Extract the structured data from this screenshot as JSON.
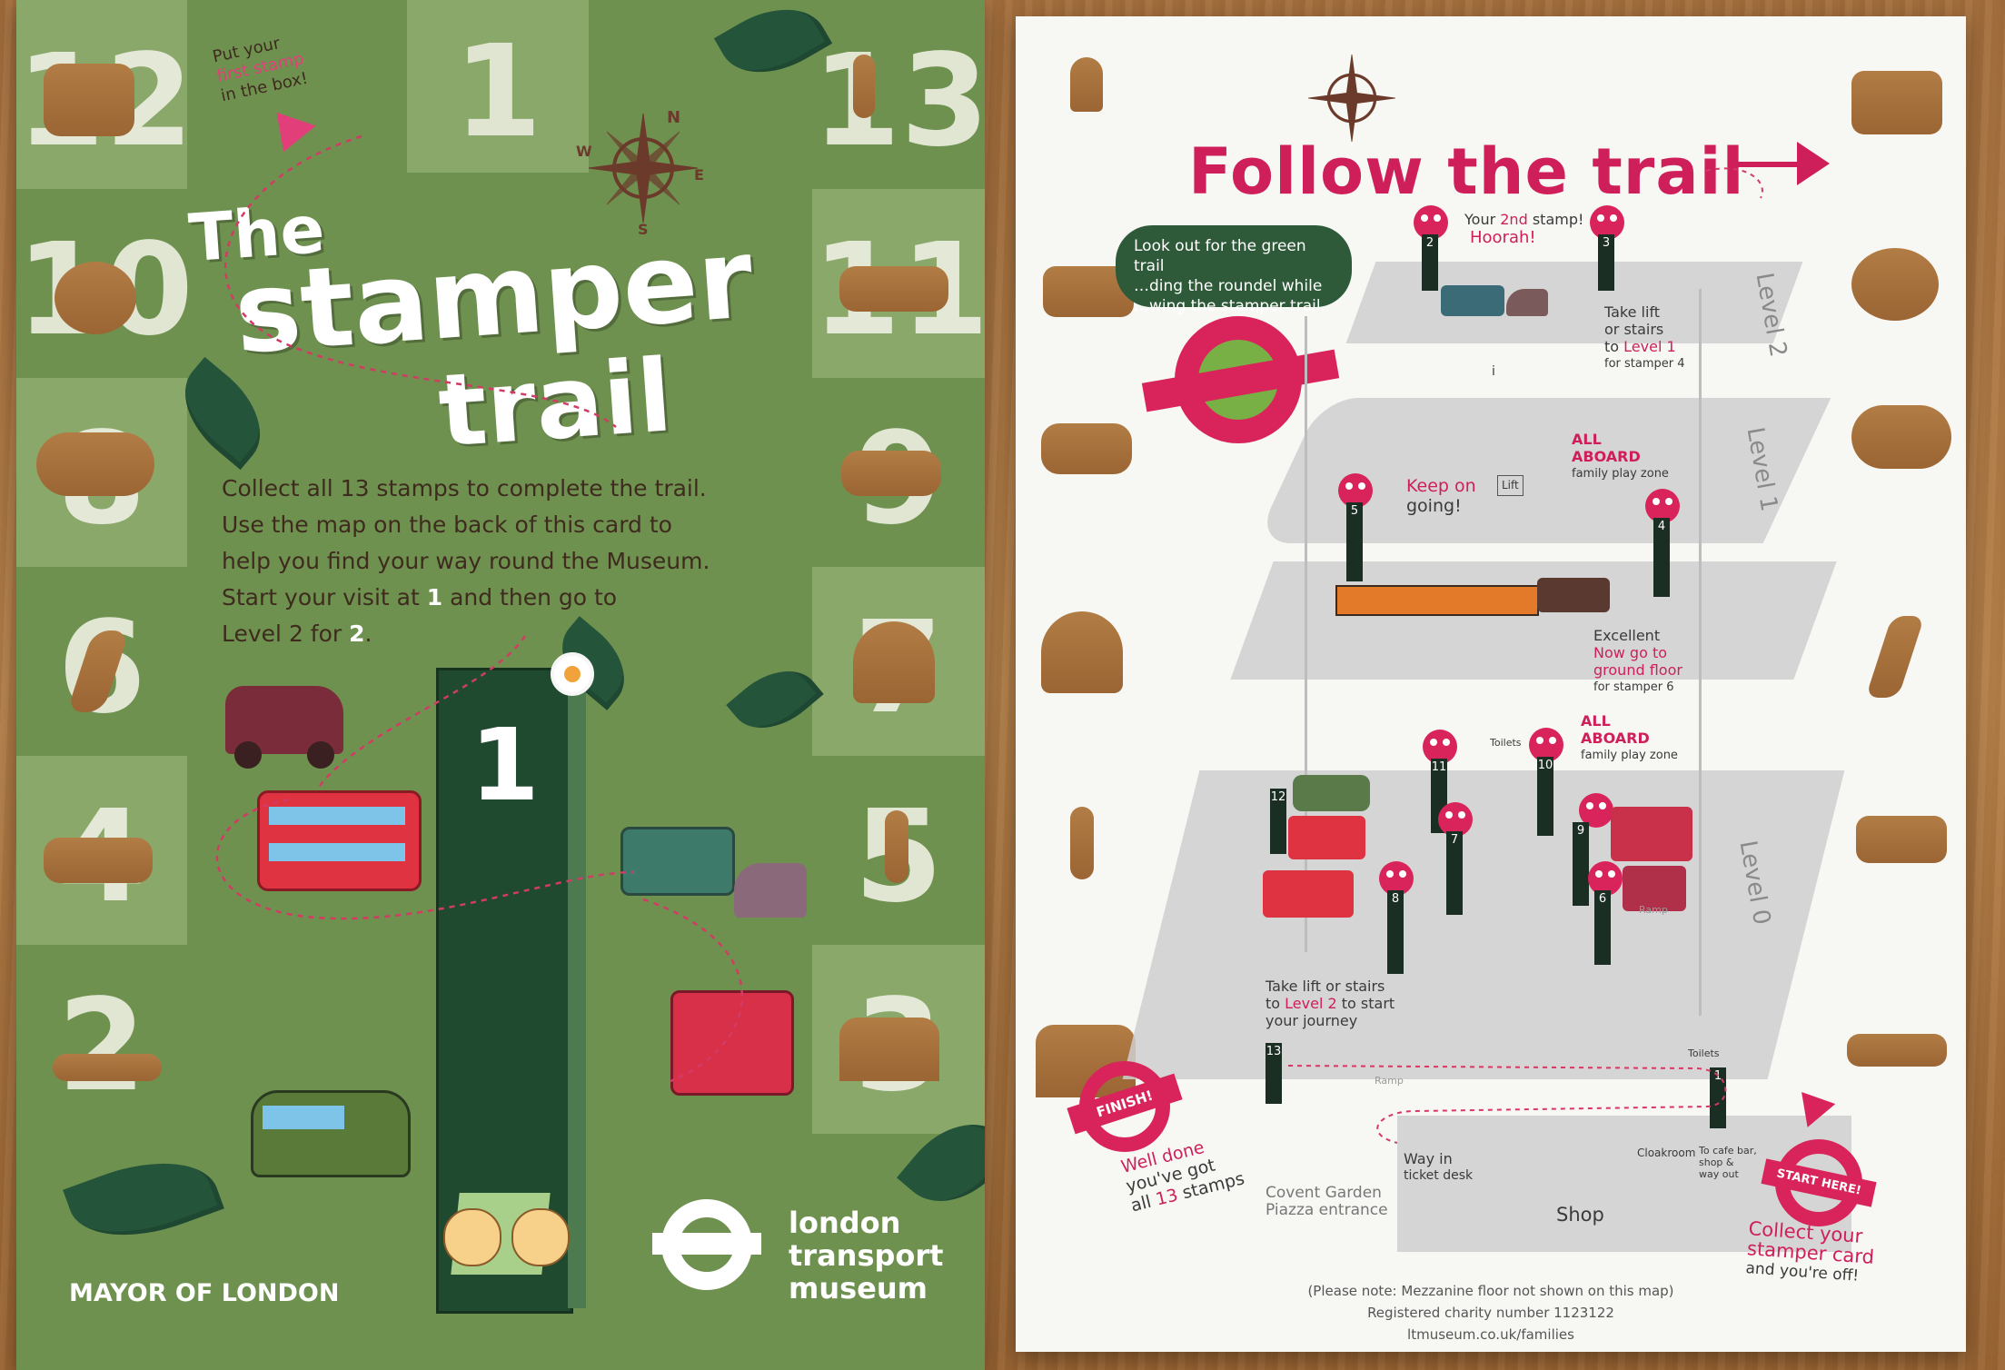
{
  "front": {
    "title_the": "The",
    "title_stamper": "stamper",
    "title_trail": "trail",
    "put_stamp_1": "Put your",
    "put_stamp_2": "first stamp",
    "put_stamp_3": "in the box!",
    "body_line1": "Collect all 13 stamps to complete the trail.",
    "body_line2": "Use the map on the back of this card to",
    "body_line3": "help you find your way round the Museum.",
    "start_a": "Start your visit at",
    "start_one": "1",
    "start_b": "and then go to",
    "start_c": "Level 2 for",
    "start_two": "2",
    "start_d": ".",
    "big_one": "1",
    "mayor": "MAYOR OF LONDON",
    "brand_1": "london",
    "brand_2": "transport",
    "brand_3": "museum",
    "left_numbers": [
      "12",
      "10",
      "8",
      "6",
      "4",
      "2"
    ],
    "top_number": "1",
    "right_numbers": [
      "13",
      "11",
      "9",
      "7",
      "5",
      "3"
    ],
    "colors": {
      "card_green": "#6f9150",
      "dark_green": "#1f4a30",
      "pink": "#e23f7a",
      "text_brown": "#3e2b1e"
    }
  },
  "back": {
    "title": "Follow the trail",
    "bubble_line1": "Look out for the green trail",
    "bubble_line2": "…ding the roundel while",
    "bubble_line3": "…wing the stamper trail.",
    "your_2nd_a": "Your",
    "your_2nd_b": "2nd",
    "your_2nd_c": "stamp!",
    "hoorah": "Hoorah!",
    "take_lift_1": "Take lift",
    "take_lift_2": "or stairs",
    "take_lift_3": "to",
    "take_lift_level": "Level 1",
    "take_lift_4": "for stamper 4",
    "level2": "Level 2",
    "level1": "Level 1",
    "level0": "Level 0",
    "all_aboard_1a": "ALL",
    "all_aboard_1b": "ABOARD",
    "family_zone_1": "family play zone",
    "keep_on": "Keep on",
    "going": "going!",
    "lift": "Lift",
    "info": "i",
    "excellent": "Excellent",
    "now_go_1": "Now go to",
    "now_go_2": "ground floor",
    "for_stamper6": "for stamper 6",
    "all_aboard_2a": "ALL",
    "all_aboard_2b": "ABOARD",
    "family_zone_2": "family play zone",
    "toilets_1": "Toilets",
    "toilets_2": "Toilets",
    "ramp_1": "Ramp",
    "ramp_2": "Ramp",
    "take_lift_start_1": "Take lift or stairs",
    "take_lift_start_2a": "to",
    "take_lift_start_2b": "Level 2",
    "take_lift_start_2c": "to start",
    "take_lift_start_3": "your journey",
    "finish": "FINISH!",
    "well_done_1": "Well done",
    "well_done_2": "you've got",
    "well_done_3a": "all",
    "well_done_3b": "13",
    "well_done_3c": "stamps",
    "way_in_1": "Way in",
    "way_in_2": "ticket desk",
    "cloakroom": "Cloakroom",
    "cafe_1": "To cafe bar,",
    "cafe_2": "shop &",
    "cafe_3": "way out",
    "start_here": "START HERE!",
    "covent_1": "Covent Garden",
    "covent_2": "Piazza entrance",
    "shop": "Shop",
    "collect_1": "Collect your",
    "collect_2": "stamper card",
    "collect_3": "and you're off!",
    "note": "(Please note: Mezzanine floor not shown on this map)",
    "charity": "Registered charity number 1123122",
    "url": "ltmuseum.co.uk/families",
    "post_numbers": [
      "2",
      "3",
      "5",
      "4",
      "12",
      "11",
      "10",
      "7",
      "9",
      "8",
      "6",
      "13",
      "1"
    ],
    "compass_n": "N",
    "compass_e": "E",
    "compass_s": "S",
    "compass_w": "W",
    "colors": {
      "title_pink": "#cf1f5b",
      "floor_grey": "#cfcfcf",
      "post_dark": "#1b2e24"
    }
  }
}
